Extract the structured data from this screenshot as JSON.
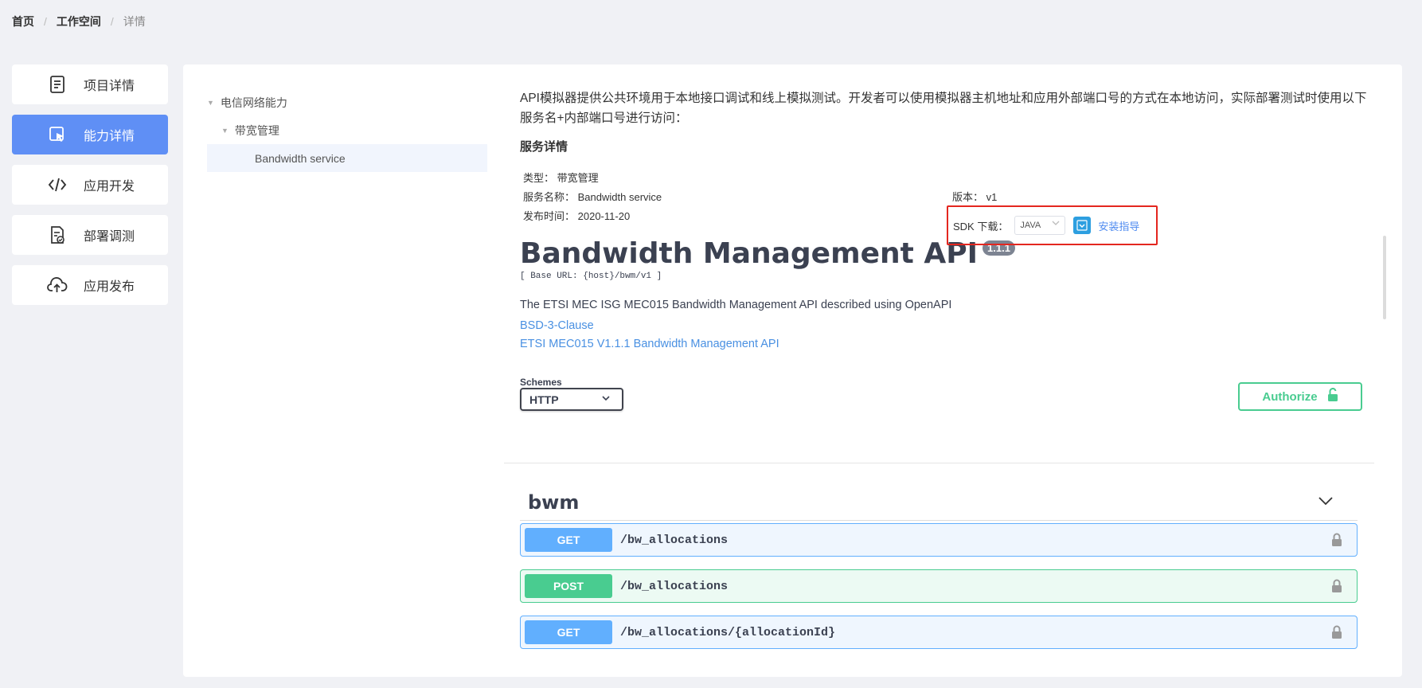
{
  "breadcrumb": {
    "home": "首页",
    "workspace": "工作空间",
    "current": "详情",
    "sep": "/"
  },
  "nav": [
    {
      "label": "项目详情",
      "icon": "document-icon"
    },
    {
      "label": "能力详情",
      "icon": "cursor-click-icon"
    },
    {
      "label": "应用开发",
      "icon": "code-icon"
    },
    {
      "label": "部署调测",
      "icon": "clipboard-check-icon"
    },
    {
      "label": "应用发布",
      "icon": "cloud-upload-icon"
    }
  ],
  "tree": {
    "root": "电信网络能力",
    "group": "带宽管理",
    "leaf": "Bandwidth service"
  },
  "intro": "API模拟器提供公共环境用于本地接口调试和线上模拟测试。开发者可以使用模拟器主机地址和应用外部端口号的方式在本地访问，实际部署测试时使用以下服务名+内部端口号进行访问：",
  "service": {
    "title": "服务详情",
    "type_label": "类型：",
    "type_value": "带宽管理",
    "name_label": "服务名称：",
    "name_value": "Bandwidth service",
    "date_label": "发布时间：",
    "date_value": "2020-11-20",
    "version_label": "版本：",
    "version_value": "v1",
    "sdk_label": "SDK 下载：",
    "sdk_value": "JAVA",
    "install_label": "安装指导"
  },
  "api": {
    "title": "Bandwidth Management API",
    "version": "1.1.1",
    "base_url": "[ Base URL: {host}/bwm/v1 ]",
    "description": "The ETSI MEC ISG MEC015 Bandwidth Management API described using OpenAPI",
    "license_link": "BSD-3-Clause",
    "docs_link": "ETSI MEC015 V1.1.1 Bandwidth Management API"
  },
  "schemes": {
    "label": "Schemes",
    "value": "HTTP"
  },
  "authorize_label": "Authorize",
  "tag": "bwm",
  "operations": [
    {
      "method": "GET",
      "path": "/bw_allocations"
    },
    {
      "method": "POST",
      "path": "/bw_allocations"
    },
    {
      "method": "GET",
      "path": "/bw_allocations/{allocationId}"
    }
  ],
  "colors": {
    "active_nav": "#5f8ff5",
    "get": "#61affe",
    "post": "#49cc90",
    "highlight_border": "#e4261f",
    "link": "#4990e2"
  }
}
